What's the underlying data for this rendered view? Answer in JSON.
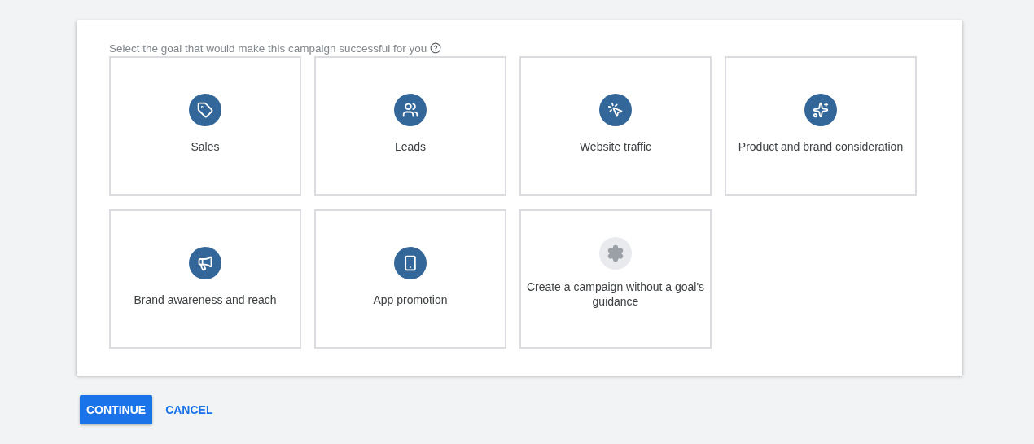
{
  "prompt": "Select the goal that would make this campaign successful for you",
  "goals": [
    {
      "label": "Sales",
      "kind": "goal",
      "selected": false
    },
    {
      "label": "Leads",
      "kind": "goal",
      "selected": false
    },
    {
      "label": "Website traffic",
      "kind": "goal",
      "selected": false
    },
    {
      "label": "Product and brand consideration",
      "kind": "goal",
      "selected": false
    },
    {
      "label": "Brand awareness and reach",
      "kind": "goal",
      "selected": false
    },
    {
      "label": "App promotion",
      "kind": "goal",
      "selected": false
    },
    {
      "label": "Create a campaign without a goal's guidance",
      "kind": "no_goal",
      "selected": false
    }
  ],
  "buttons": [
    {
      "label": "CONTINUE",
      "kind": "primary"
    },
    {
      "label": "CANCEL",
      "kind": "text"
    }
  ]
}
